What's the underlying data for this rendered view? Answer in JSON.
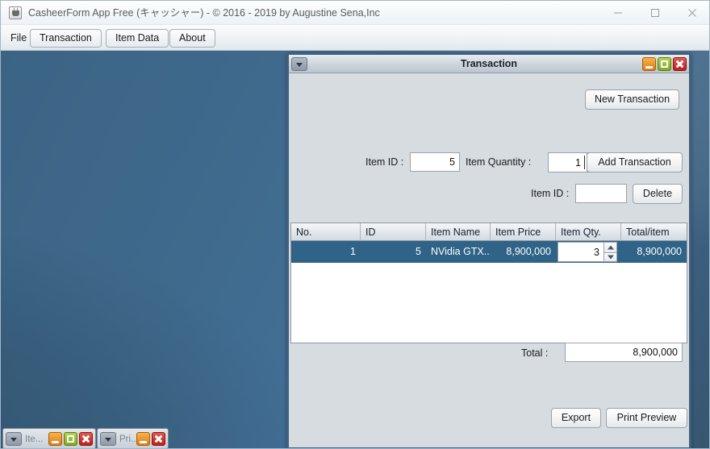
{
  "window": {
    "title": "CasheerForm App Free (キャッシャー) - © 2016 - 2019 by Augustine Sena,Inc",
    "icon": "java-coffee-cup-icon",
    "controls": {
      "minimize": "minimize-icon",
      "maximize": "maximize-icon",
      "close": "close-icon"
    }
  },
  "menubar": {
    "file_label": "File",
    "buttons": [
      {
        "label": "Transaction"
      },
      {
        "label": "Item Data"
      },
      {
        "label": "About"
      }
    ]
  },
  "transaction_frame": {
    "title": "Transaction",
    "new_transaction_label": "New Transaction",
    "item_id_label": "Item ID :",
    "item_id_value": "5",
    "item_quantity_label": "Item Quantity :",
    "item_quantity_value": "1",
    "add_transaction_label": "Add Transaction",
    "delete_item_id_label": "Item ID :",
    "delete_item_id_value": "",
    "delete_item_id_placeholder": "",
    "delete_label": "Delete",
    "total_label": "Total :",
    "total_value": "8,900,000",
    "export_label": "Export",
    "print_preview_label": "Print Preview",
    "table": {
      "columns": [
        "No.",
        "ID",
        "Item Name",
        "Item Price",
        "Item Qty.",
        "Total/item"
      ],
      "rows": [
        {
          "no": "1",
          "id": "5",
          "item_name": "NVidia GTX...",
          "item_price": "8,900,000",
          "item_qty": "3",
          "total_item": "8,900,000"
        }
      ]
    }
  },
  "taskbar": {
    "items": [
      {
        "label": "Ite...",
        "has_maximize": true
      },
      {
        "label": "Pri...",
        "has_maximize": false
      }
    ]
  },
  "colors": {
    "desktop_blue": "#3f6a8d",
    "frame_border": "#41607e",
    "selection_blue": "#2f6387",
    "panel_gray": "#d7dce1",
    "btn_min_orange": "#e07c18",
    "btn_max_green": "#7fa820",
    "btn_close_red": "#be1f1a"
  }
}
